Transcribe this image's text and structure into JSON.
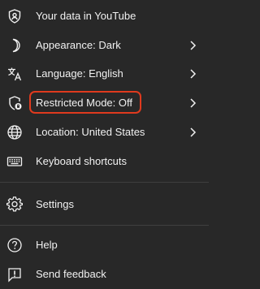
{
  "menu": {
    "items": [
      {
        "label": "Your data in YouTube",
        "icon": "shield-person-icon",
        "has_submenu": false
      },
      {
        "label": "Appearance: Dark",
        "icon": "moon-icon",
        "has_submenu": true
      },
      {
        "label": "Language: English",
        "icon": "translate-icon",
        "has_submenu": true
      },
      {
        "label": "Restricted Mode: Off",
        "icon": "shield-lock-icon",
        "has_submenu": true,
        "highlighted": true
      },
      {
        "label": "Location: United States",
        "icon": "globe-icon",
        "has_submenu": true
      },
      {
        "label": "Keyboard shortcuts",
        "icon": "keyboard-icon",
        "has_submenu": false
      },
      {
        "label": "Settings",
        "icon": "gear-icon",
        "has_submenu": false
      },
      {
        "label": "Help",
        "icon": "help-icon",
        "has_submenu": false
      },
      {
        "label": "Send feedback",
        "icon": "feedback-icon",
        "has_submenu": false
      }
    ]
  },
  "colors": {
    "background": "#282828",
    "text": "#f1f1f1",
    "divider": "#3f3f3f",
    "highlight_border": "#e03a1e"
  }
}
